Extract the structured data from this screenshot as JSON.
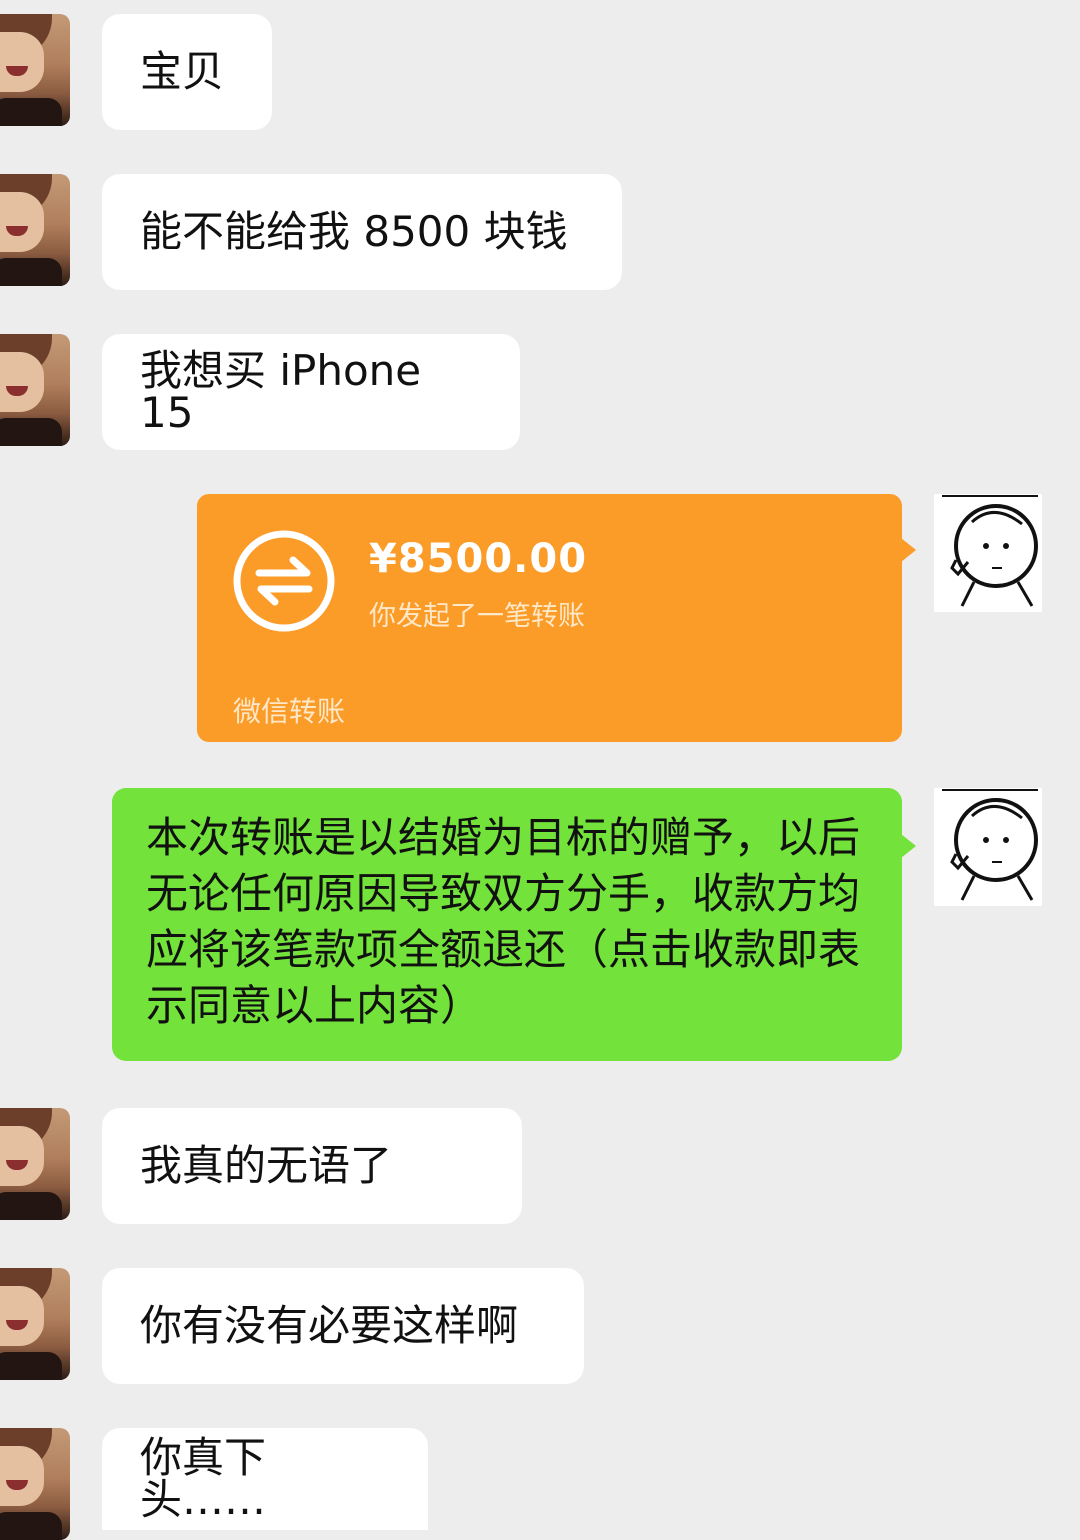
{
  "messages": [
    {
      "text": "宝贝"
    },
    {
      "text": "能不能给我 8500 块钱"
    },
    {
      "text": "我想买 iPhone 15"
    }
  ],
  "transfer": {
    "amount": "¥8500.00",
    "description": "你发起了一笔转账",
    "footer": "微信转账",
    "color": "#fb9b28"
  },
  "green_message": {
    "text": "本次转账是以结婚为目标的赠予，以后无论任何原因导致双方分手，收款方均应将该笔款项全额退还（点击收款即表示同意以上内容）",
    "color": "#73e23b"
  },
  "replies": [
    {
      "text": "我真的无语了"
    },
    {
      "text": "你有没有必要这样啊"
    },
    {
      "text": "你真下头……"
    }
  ],
  "icons": {
    "transfer": "transfer-arrows-icon",
    "avatar_contact": "contact-avatar",
    "avatar_self": "self-avatar-cartoon"
  }
}
